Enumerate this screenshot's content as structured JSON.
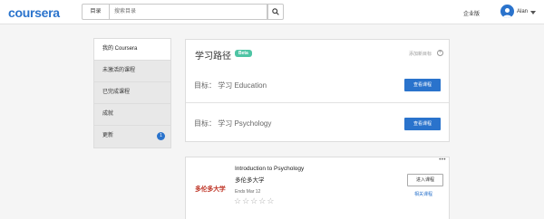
{
  "header": {
    "logo": "coursera",
    "catalog_label": "目录",
    "search_placeholder": "搜索目录",
    "enterprise_label": "企业版",
    "username": "Alan",
    "accent_color": "#2a73cc"
  },
  "sidebar": {
    "items": [
      {
        "label": "我的 Coursera",
        "active": true
      },
      {
        "label": "未激活的课程"
      },
      {
        "label": "已完成课程"
      },
      {
        "label": "成就"
      },
      {
        "label": "更新",
        "badge": "1"
      }
    ]
  },
  "learning_paths": {
    "title": "学习路径",
    "beta_badge": "Beta",
    "add_goal": "添加新目标",
    "goals": [
      {
        "label": "目标：  学习 Education",
        "button": "查看课程"
      },
      {
        "label": "目标：  学习 Psychology",
        "button": "查看课程"
      }
    ]
  },
  "course": {
    "logo_text": "多伦多大学",
    "title": "Introduction to Psychology",
    "university": "多伦多大学",
    "ends": "Ends Mar 12",
    "enter_button": "进入课程",
    "link": "相关课程",
    "rating": 0,
    "rating_max": 5
  }
}
